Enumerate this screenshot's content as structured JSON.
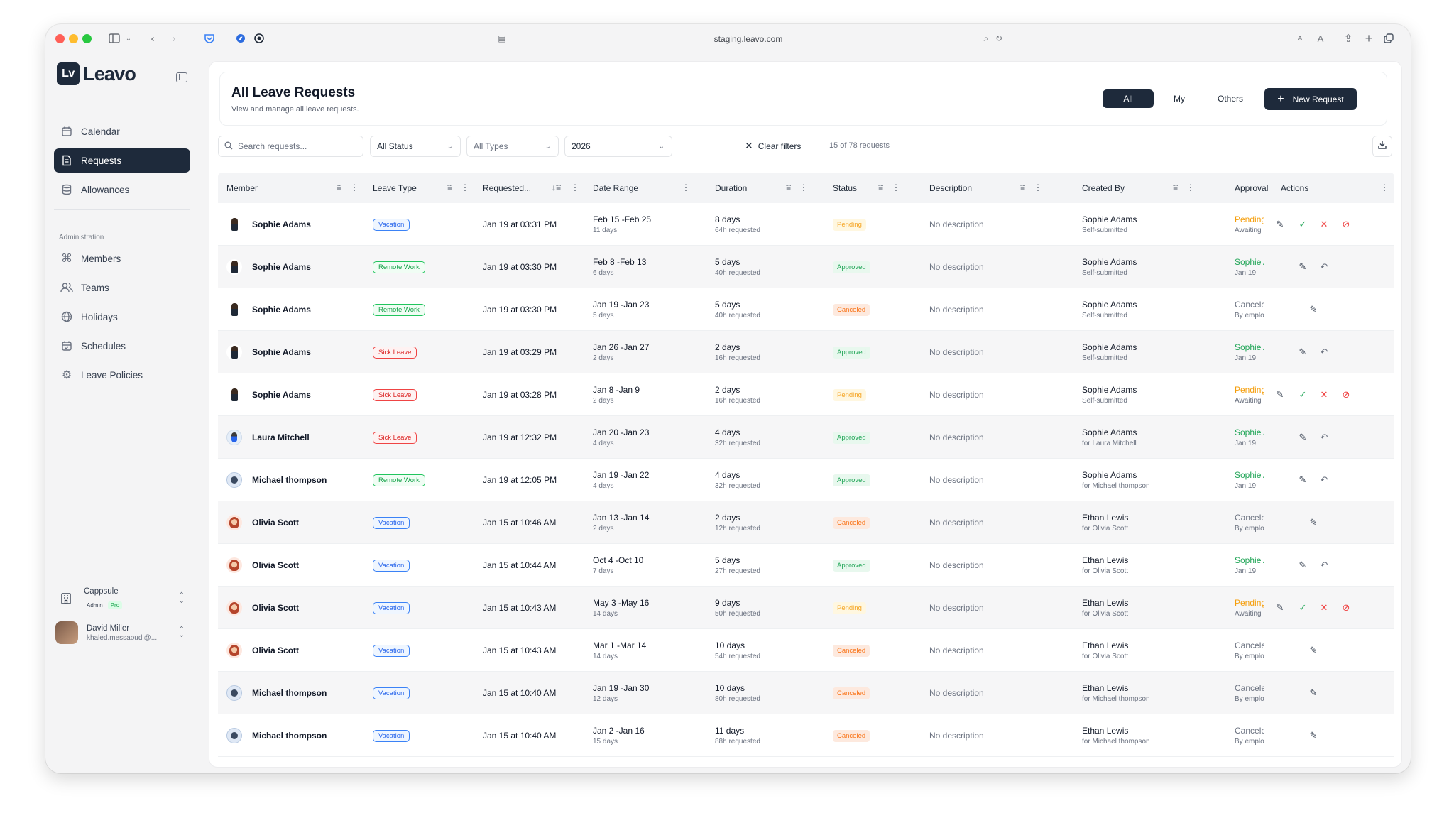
{
  "browser": {
    "url": "staging.leavo.com"
  },
  "app": {
    "logo_mark": "Lv",
    "logo_text": "Leavo"
  },
  "sidebar": {
    "main_items": [
      {
        "label": "Calendar",
        "icon": "calendar-icon"
      },
      {
        "label": "Requests",
        "icon": "document-icon",
        "active": true
      },
      {
        "label": "Allowances",
        "icon": "database-icon"
      }
    ],
    "section_label": "Administration",
    "admin_items": [
      {
        "label": "Members",
        "icon": "command-icon"
      },
      {
        "label": "Teams",
        "icon": "users-icon"
      },
      {
        "label": "Holidays",
        "icon": "globe-icon"
      },
      {
        "label": "Schedules",
        "icon": "calendar-check-icon"
      },
      {
        "label": "Leave Policies",
        "icon": "gear-icon"
      }
    ],
    "org": {
      "name": "Cappsule",
      "role": "Admin",
      "plan": "Pro"
    },
    "user": {
      "name": "David Miller",
      "email": "khaled.messaoudi@..."
    }
  },
  "header": {
    "title": "All Leave Requests",
    "subtitle": "View and manage all leave requests.",
    "scopes": [
      "All",
      "My",
      "Others"
    ],
    "active_scope": "All",
    "new_button": "New Request"
  },
  "filters": {
    "search_placeholder": "Search requests...",
    "status": "All Status",
    "type": "All Types",
    "year": "2026",
    "clear_label": "Clear filters",
    "count_text": "15 of 78 requests"
  },
  "table": {
    "columns": [
      "Member",
      "Leave Type",
      "Requested...",
      "Date Range",
      "Duration",
      "Status",
      "Description",
      "Created By",
      "Approval",
      "Actions"
    ],
    "rows": [
      {
        "member": "Sophie Adams",
        "avatar": "sophie",
        "type": "Vacation",
        "type_class": "vac",
        "requested": "Jan 19 at 03:31 PM",
        "range": "Feb 15 -Feb 25",
        "range_days": "11 days",
        "duration": "8 days",
        "hours": "64h requested",
        "status": "Pending",
        "status_class": "pending",
        "description": "No description",
        "created_by": "Sophie Adams",
        "created_sub": "Self-submitted",
        "approval": "Pending",
        "approval_sub": "Awaiting re",
        "actions": [
          "edit",
          "approve",
          "reject",
          "cancel"
        ]
      },
      {
        "member": "Sophie Adams",
        "avatar": "sophie",
        "type": "Remote Work",
        "type_class": "rem",
        "requested": "Jan 19 at 03:30 PM",
        "range": "Feb 8 -Feb 13",
        "range_days": "6 days",
        "duration": "5 days",
        "hours": "40h requested",
        "status": "Approved",
        "status_class": "approved",
        "description": "No description",
        "created_by": "Sophie Adams",
        "created_sub": "Self-submitted",
        "approval": "Sophie Ac",
        "approval_sub": "Jan 19",
        "actions": [
          "edit",
          "undo"
        ]
      },
      {
        "member": "Sophie Adams",
        "avatar": "sophie",
        "type": "Remote Work",
        "type_class": "rem",
        "requested": "Jan 19 at 03:30 PM",
        "range": "Jan 19 -Jan 23",
        "range_days": "5 days",
        "duration": "5 days",
        "hours": "40h requested",
        "status": "Canceled",
        "status_class": "canceled",
        "description": "No description",
        "created_by": "Sophie Adams",
        "created_sub": "Self-submitted",
        "approval": "Canceled",
        "approval_sub": "By employe",
        "actions": [
          "edit"
        ]
      },
      {
        "member": "Sophie Adams",
        "avatar": "sophie",
        "type": "Sick Leave",
        "type_class": "sick",
        "requested": "Jan 19 at 03:29 PM",
        "range": "Jan 26 -Jan 27",
        "range_days": "2 days",
        "duration": "2 days",
        "hours": "16h requested",
        "status": "Approved",
        "status_class": "approved",
        "description": "No description",
        "created_by": "Sophie Adams",
        "created_sub": "Self-submitted",
        "approval": "Sophie Ac",
        "approval_sub": "Jan 19",
        "actions": [
          "edit",
          "undo"
        ]
      },
      {
        "member": "Sophie Adams",
        "avatar": "sophie",
        "type": "Sick Leave",
        "type_class": "sick",
        "requested": "Jan 19 at 03:28 PM",
        "range": "Jan 8 -Jan 9",
        "range_days": "2 days",
        "duration": "2 days",
        "hours": "16h requested",
        "status": "Pending",
        "status_class": "pending",
        "description": "No description",
        "created_by": "Sophie Adams",
        "created_sub": "Self-submitted",
        "approval": "Pending",
        "approval_sub": "Awaiting re",
        "actions": [
          "edit",
          "approve",
          "reject",
          "cancel"
        ]
      },
      {
        "member": "Laura Mitchell",
        "avatar": "laura",
        "type": "Sick Leave",
        "type_class": "sick",
        "requested": "Jan 19 at 12:32 PM",
        "range": "Jan 20 -Jan 23",
        "range_days": "4 days",
        "duration": "4 days",
        "hours": "32h requested",
        "status": "Approved",
        "status_class": "approved",
        "description": "No description",
        "created_by": "Sophie Adams",
        "created_sub": "for Laura Mitchell",
        "approval": "Sophie Ac",
        "approval_sub": "Jan 19",
        "actions": [
          "edit",
          "undo"
        ]
      },
      {
        "member": "Michael thompson",
        "avatar": "michael",
        "type": "Remote Work",
        "type_class": "rem",
        "requested": "Jan 19 at 12:05 PM",
        "range": "Jan 19 -Jan 22",
        "range_days": "4 days",
        "duration": "4 days",
        "hours": "32h requested",
        "status": "Approved",
        "status_class": "approved",
        "description": "No description",
        "created_by": "Sophie Adams",
        "created_sub": "for Michael thompson",
        "approval": "Sophie Ac",
        "approval_sub": "Jan 19",
        "actions": [
          "edit",
          "undo"
        ]
      },
      {
        "member": "Olivia Scott",
        "avatar": "olivia",
        "type": "Vacation",
        "type_class": "vac",
        "requested": "Jan 15 at 10:46 AM",
        "range": "Jan 13 -Jan 14",
        "range_days": "2 days",
        "duration": "2 days",
        "hours": "12h requested",
        "status": "Canceled",
        "status_class": "canceled",
        "description": "No description",
        "created_by": "Ethan Lewis",
        "created_sub": "for Olivia Scott",
        "approval": "Canceled",
        "approval_sub": "By employe",
        "actions": [
          "edit"
        ]
      },
      {
        "member": "Olivia Scott",
        "avatar": "olivia",
        "type": "Vacation",
        "type_class": "vac",
        "requested": "Jan 15 at 10:44 AM",
        "range": "Oct 4 -Oct 10",
        "range_days": "7 days",
        "duration": "5 days",
        "hours": "27h requested",
        "status": "Approved",
        "status_class": "approved",
        "description": "No description",
        "created_by": "Ethan Lewis",
        "created_sub": "for Olivia Scott",
        "approval": "Sophie Ac",
        "approval_sub": "Jan 19",
        "actions": [
          "edit",
          "undo"
        ]
      },
      {
        "member": "Olivia Scott",
        "avatar": "olivia",
        "type": "Vacation",
        "type_class": "vac",
        "requested": "Jan 15 at 10:43 AM",
        "range": "May 3 -May 16",
        "range_days": "14 days",
        "duration": "9 days",
        "hours": "50h requested",
        "status": "Pending",
        "status_class": "pending",
        "description": "No description",
        "created_by": "Ethan Lewis",
        "created_sub": "for Olivia Scott",
        "approval": "Pending",
        "approval_sub": "Awaiting re",
        "actions": [
          "edit",
          "approve",
          "reject",
          "cancel"
        ]
      },
      {
        "member": "Olivia Scott",
        "avatar": "olivia",
        "type": "Vacation",
        "type_class": "vac",
        "requested": "Jan 15 at 10:43 AM",
        "range": "Mar 1 -Mar 14",
        "range_days": "14 days",
        "duration": "10 days",
        "hours": "54h requested",
        "status": "Canceled",
        "status_class": "canceled",
        "description": "No description",
        "created_by": "Ethan Lewis",
        "created_sub": "for Olivia Scott",
        "approval": "Canceled",
        "approval_sub": "By employe",
        "actions": [
          "edit"
        ]
      },
      {
        "member": "Michael thompson",
        "avatar": "michael",
        "type": "Vacation",
        "type_class": "vac",
        "requested": "Jan 15 at 10:40 AM",
        "range": "Jan 19 -Jan 30",
        "range_days": "12 days",
        "duration": "10 days",
        "hours": "80h requested",
        "status": "Canceled",
        "status_class": "canceled",
        "description": "No description",
        "created_by": "Ethan Lewis",
        "created_sub": "for Michael thompson",
        "approval": "Canceled",
        "approval_sub": "By employe",
        "actions": [
          "edit"
        ]
      },
      {
        "member": "Michael thompson",
        "avatar": "michael",
        "type": "Vacation",
        "type_class": "vac",
        "requested": "Jan 15 at 10:40 AM",
        "range": "Jan 2 -Jan 16",
        "range_days": "15 days",
        "duration": "11 days",
        "hours": "88h requested",
        "status": "Canceled",
        "status_class": "canceled",
        "description": "No description",
        "created_by": "Ethan Lewis",
        "created_sub": "for Michael thompson",
        "approval": "Canceled",
        "approval_sub": "By employe",
        "actions": [
          "edit"
        ]
      }
    ]
  }
}
